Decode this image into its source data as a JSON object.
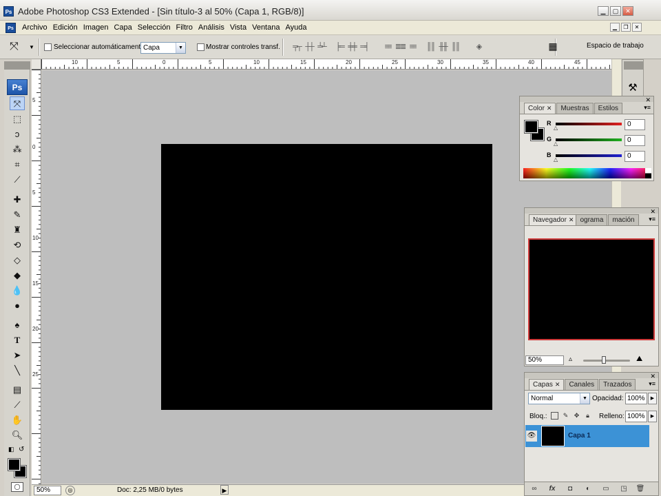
{
  "window": {
    "title": "Adobe Photoshop CS3 Extended - [Sin título-3 al 50% (Capa 1, RGB/8)]",
    "app_icon": "Ps",
    "min": "▁",
    "max": "▢",
    "close": "✕"
  },
  "menu": {
    "items": [
      "Archivo",
      "Edición",
      "Imagen",
      "Capa",
      "Selección",
      "Filtro",
      "Análisis",
      "Vista",
      "Ventana",
      "Ayuda"
    ],
    "doc_min": "▁",
    "doc_restore": "❐",
    "doc_close": "✕"
  },
  "options": {
    "auto_select_label": "Seleccionar automáticamente:",
    "auto_select_value": "Capa",
    "show_transform_label": "Mostrar controles transf.",
    "workspace_label": "Espacio de trabajo"
  },
  "rulers": {
    "horizontal": [
      "10",
      "5",
      "0",
      "5",
      "10",
      "15",
      "20",
      "25",
      "30",
      "35",
      "40",
      "45"
    ],
    "vertical": [
      "5",
      "0",
      "5",
      "10",
      "15",
      "20",
      "25"
    ]
  },
  "status": {
    "zoom": "50%",
    "doc_info": "Doc: 2,25 MB/0 bytes"
  },
  "tools": {
    "ps_logo": "Ps"
  },
  "color_panel": {
    "tabs": [
      "Color",
      "Muestras",
      "Estilos"
    ],
    "channels": [
      {
        "label": "R",
        "value": "0",
        "color": "#e02020"
      },
      {
        "label": "G",
        "value": "0",
        "color": "#20b020"
      },
      {
        "label": "B",
        "value": "0",
        "color": "#2020d0"
      }
    ]
  },
  "navigator_panel": {
    "tabs": [
      "Navegador",
      "ograma",
      "mación"
    ],
    "zoom": "50%"
  },
  "layers_panel": {
    "tabs": [
      "Capas",
      "Canales",
      "Trazados"
    ],
    "blend_mode": "Normal",
    "opacity_label": "Opacidad:",
    "opacity_value": "100%",
    "lock_label": "Bloq.:",
    "fill_label": "Relleno:",
    "fill_value": "100%",
    "layer_name": "Capa 1"
  }
}
